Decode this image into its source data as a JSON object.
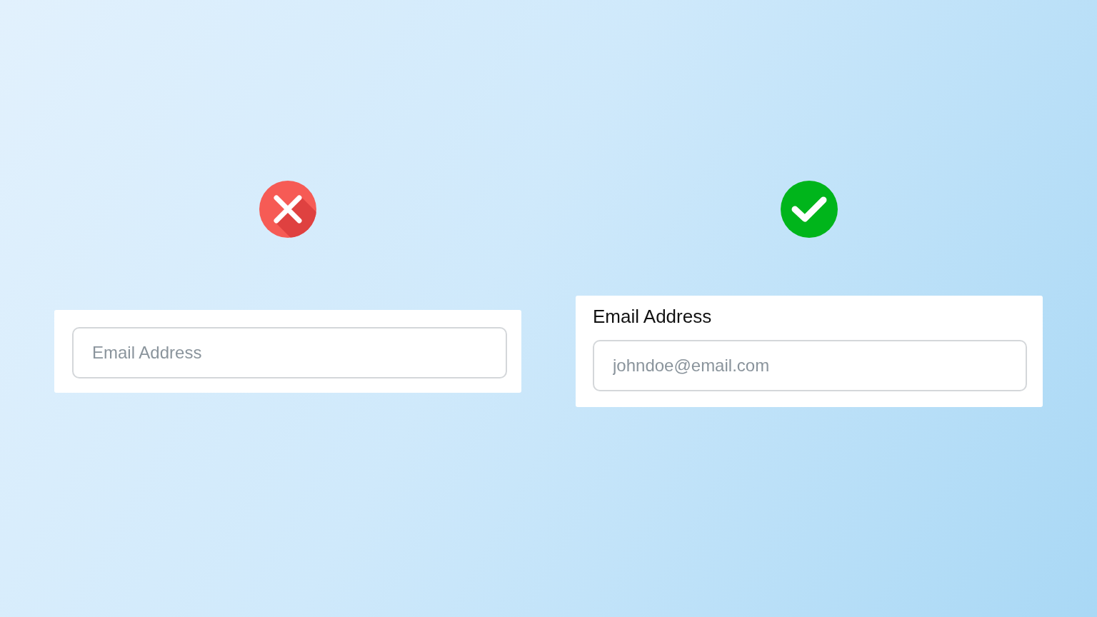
{
  "examples": [
    {
      "kind": "bad",
      "field": {
        "placeholder": "Email Address"
      }
    },
    {
      "kind": "good",
      "label": "Email Address",
      "field": {
        "placeholder": "johndoe@email.com"
      }
    }
  ]
}
